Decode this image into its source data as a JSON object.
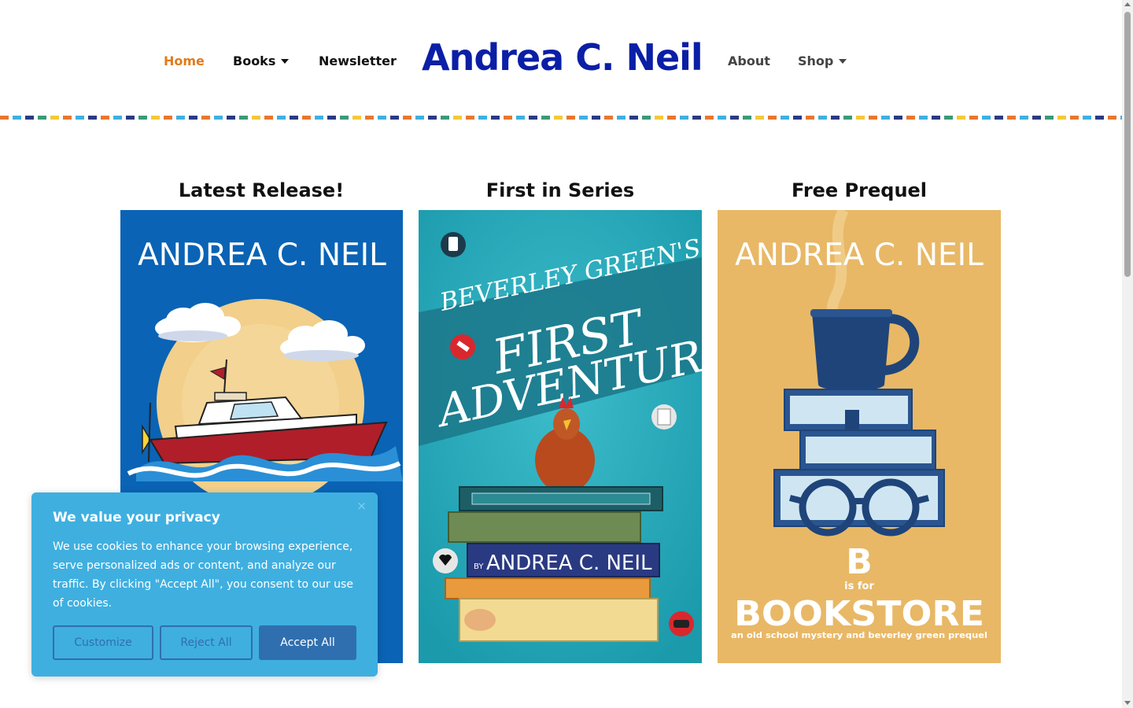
{
  "nav": {
    "home": "Home",
    "books": "Books",
    "newsletter": "Newsletter",
    "about": "About",
    "shop": "Shop"
  },
  "site_title": "Andrea C. Neil",
  "colors": {
    "accent": "#e07b1b",
    "title_blue": "#0a1fa6",
    "cookie_bg": "#3fafe0",
    "cookie_button": "#2f6fb0"
  },
  "features": [
    {
      "heading": "Latest Release!",
      "cover_author": "ANDREA C. NEIL"
    },
    {
      "heading": "First in Series",
      "cover_title_line1": "BEVERLEY GREEN'S",
      "cover_title_line2": "FIRST",
      "cover_title_line3": "ADVENTURE",
      "cover_by": "BY",
      "cover_author": "ANDREA C. NEIL"
    },
    {
      "heading": "Free Prequel",
      "cover_author": "ANDREA C. NEIL",
      "cover_letter": "B",
      "cover_is_for": "is for",
      "cover_title": "BOOKSTORE",
      "cover_subtitle": "an old school mystery and beverley green prequel"
    }
  ],
  "cookie": {
    "title": "We value your privacy",
    "close": "×",
    "text": "We use cookies to enhance your browsing experience, serve personalized ads or content, and analyze our traffic. By clicking \"Accept All\", you consent to our use of cookies.",
    "customize": "Customize",
    "reject": "Reject All",
    "accept": "Accept All"
  }
}
